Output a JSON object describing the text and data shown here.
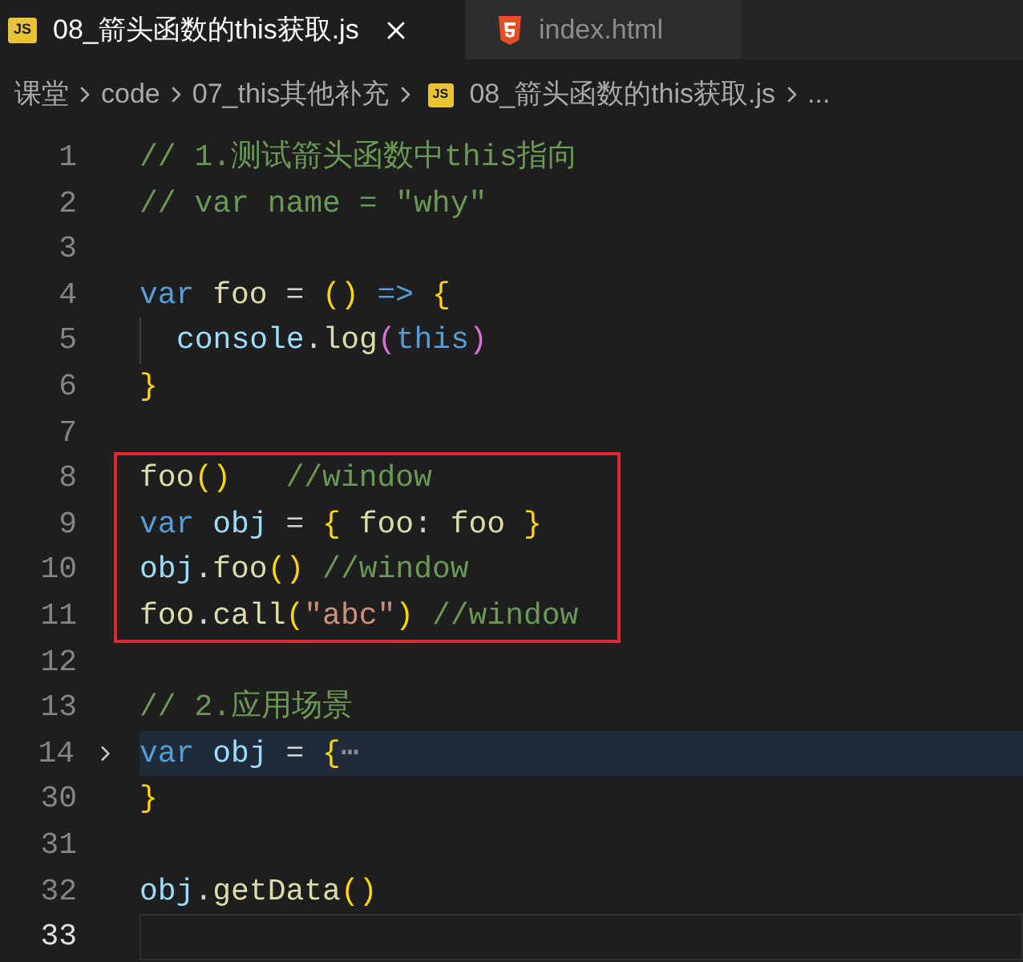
{
  "tabs": [
    {
      "label": "08_箭头函数的this获取.js",
      "kind": "js",
      "icon_text": "JS",
      "selected": true
    },
    {
      "label": "index.html",
      "kind": "html",
      "selected": false
    }
  ],
  "breadcrumb": [
    {
      "label": "课堂"
    },
    {
      "label": "code"
    },
    {
      "label": "07_this其他补充"
    },
    {
      "label": "08_箭头函数的this获取.js",
      "kind": "js",
      "icon_text": "JS"
    },
    {
      "label": "..."
    }
  ],
  "lines": [
    {
      "number": "1",
      "tokens": [
        {
          "kind": "comment",
          "text": "// 1.测试箭头函数中this指向"
        }
      ]
    },
    {
      "number": "2",
      "tokens": [
        {
          "kind": "comment",
          "text": "// var name = \"why\""
        }
      ]
    },
    {
      "number": "3"
    },
    {
      "number": "4",
      "tokens": [
        {
          "kind": "keyword",
          "text": "var"
        },
        {
          "kind": "function",
          "text": " foo"
        },
        {
          "kind": "plain",
          "text": " = "
        },
        {
          "kind": "bracket",
          "text": "()"
        },
        {
          "kind": "keyword",
          "text": " =>"
        },
        {
          "kind": "bracket",
          "text": " {"
        }
      ]
    },
    {
      "number": "5",
      "indent_guide": true,
      "tokens": [
        {
          "kind": "variable",
          "text": "console"
        },
        {
          "kind": "plain",
          "text": "."
        },
        {
          "kind": "function",
          "text": "log"
        },
        {
          "kind": "bracket2",
          "text": "("
        },
        {
          "kind": "keyword",
          "text": "this"
        },
        {
          "kind": "bracket2",
          "text": ")"
        }
      ]
    },
    {
      "number": "6",
      "tokens": [
        {
          "kind": "bracket",
          "text": "}"
        }
      ]
    },
    {
      "number": "7"
    },
    {
      "number": "8",
      "boxed": true,
      "tokens": [
        {
          "kind": "function",
          "text": "foo"
        },
        {
          "kind": "bracket",
          "text": "()"
        },
        {
          "kind": "comment",
          "text": "   //window"
        }
      ]
    },
    {
      "number": "9",
      "boxed": true,
      "tokens": [
        {
          "kind": "keyword",
          "text": "var"
        },
        {
          "kind": "variable",
          "text": " obj"
        },
        {
          "kind": "plain",
          "text": " = "
        },
        {
          "kind": "bracket",
          "text": "{"
        },
        {
          "kind": "function",
          "text": " foo"
        },
        {
          "kind": "plain",
          "text": ": "
        },
        {
          "kind": "function",
          "text": "foo"
        },
        {
          "kind": "bracket",
          "text": " }"
        }
      ]
    },
    {
      "number": "10",
      "boxed": true,
      "tokens": [
        {
          "kind": "variable",
          "text": "obj"
        },
        {
          "kind": "plain",
          "text": "."
        },
        {
          "kind": "function",
          "text": "foo"
        },
        {
          "kind": "bracket",
          "text": "()"
        },
        {
          "kind": "comment",
          "text": " //window"
        }
      ]
    },
    {
      "number": "11",
      "boxed": true,
      "tokens": [
        {
          "kind": "function",
          "text": "foo"
        },
        {
          "kind": "plain",
          "text": "."
        },
        {
          "kind": "function",
          "text": "call"
        },
        {
          "kind": "bracket",
          "text": "("
        },
        {
          "kind": "string",
          "text": "\"abc\""
        },
        {
          "kind": "bracket",
          "text": ")"
        },
        {
          "kind": "comment",
          "text": " //window"
        }
      ]
    },
    {
      "number": "12"
    },
    {
      "number": "13",
      "tokens": [
        {
          "kind": "comment",
          "text": "// 2.应用场景"
        }
      ]
    },
    {
      "number": "14",
      "folded": true,
      "highlighted": true,
      "tokens": [
        {
          "kind": "keyword",
          "text": "var"
        },
        {
          "kind": "variable",
          "text": " obj"
        },
        {
          "kind": "plain",
          "text": " = "
        },
        {
          "kind": "bracket",
          "text": "{"
        },
        {
          "kind": "fold",
          "text": "⋯"
        }
      ]
    },
    {
      "number": "30",
      "tokens": [
        {
          "kind": "bracket",
          "text": "}"
        }
      ]
    },
    {
      "number": "31"
    },
    {
      "number": "32",
      "tokens": [
        {
          "kind": "variable",
          "text": "obj"
        },
        {
          "kind": "plain",
          "text": "."
        },
        {
          "kind": "function",
          "text": "getData"
        },
        {
          "kind": "bracket",
          "text": "()"
        }
      ]
    },
    {
      "number": "33",
      "current": true
    }
  ]
}
